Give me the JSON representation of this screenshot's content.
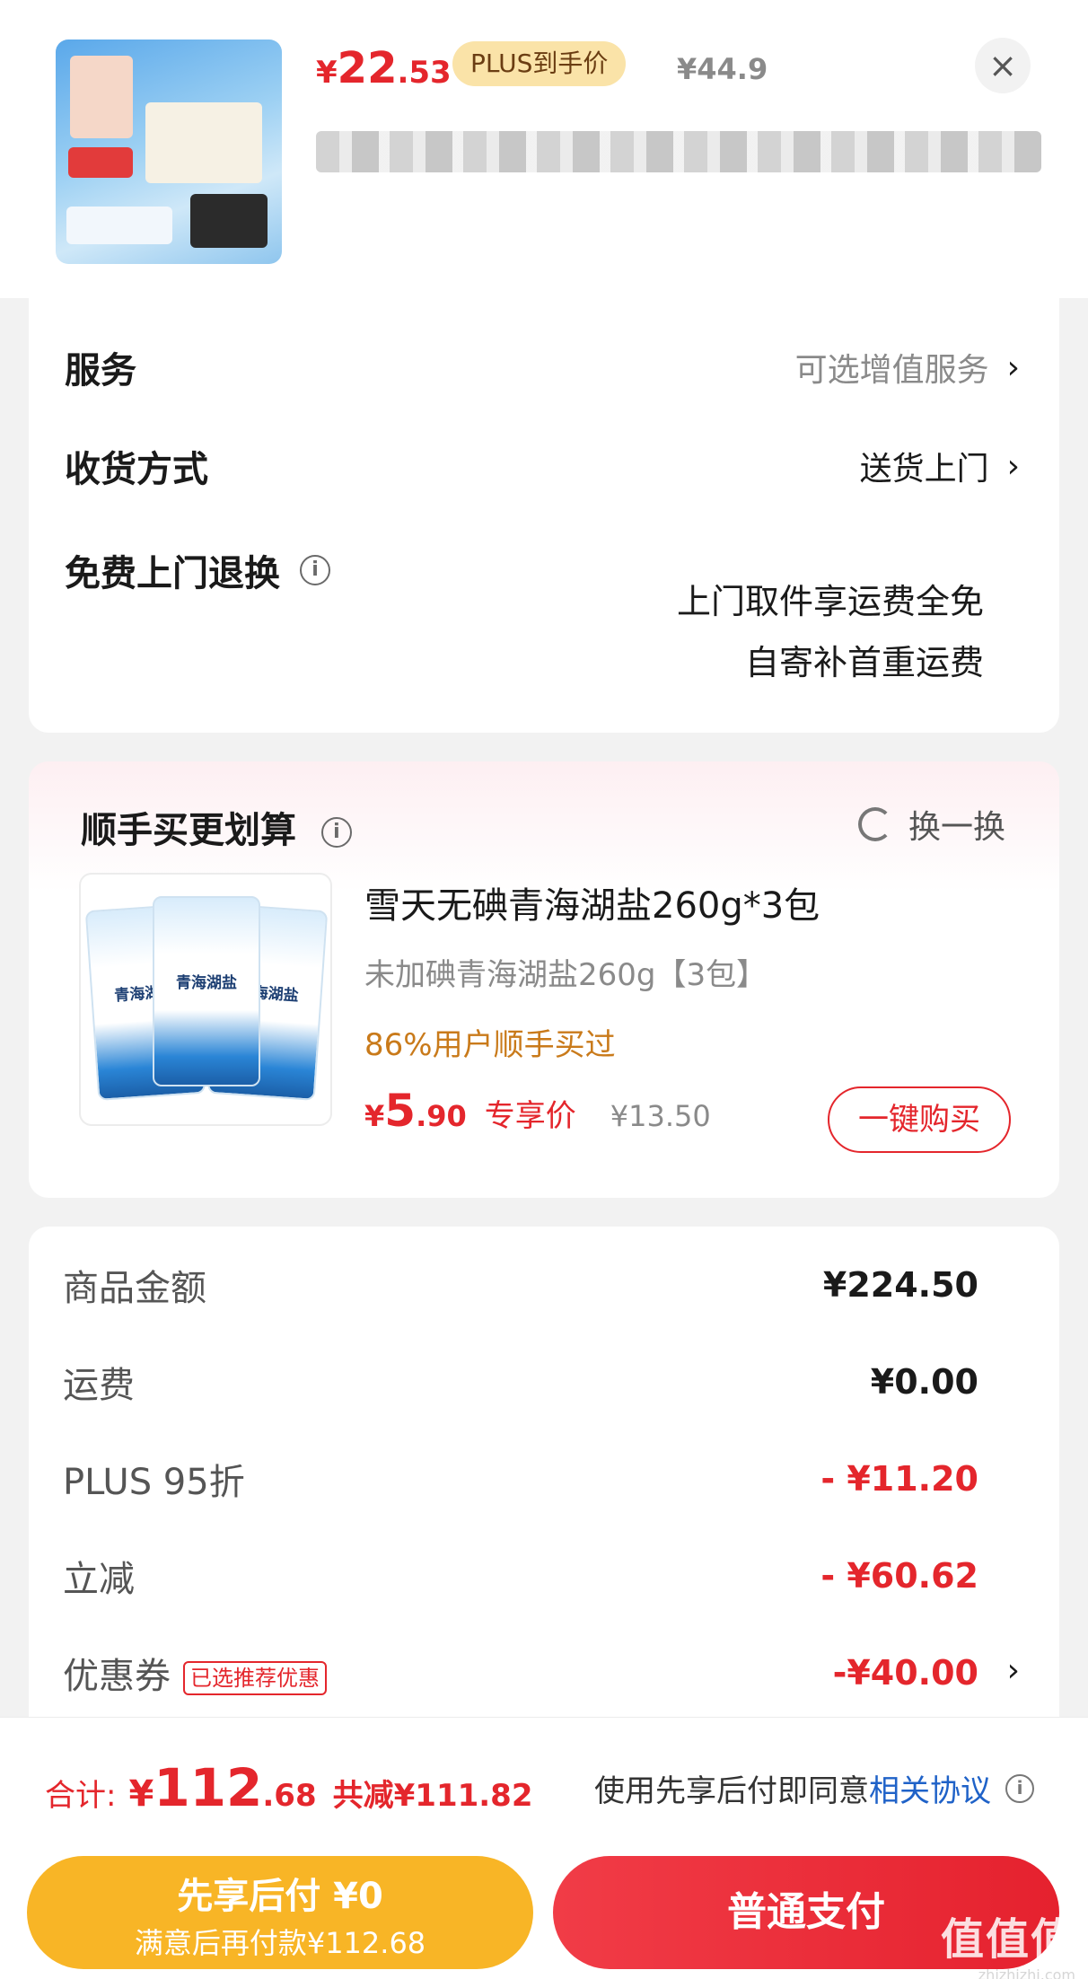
{
  "header": {
    "price_currency": "¥",
    "price_int": "22",
    "price_dec": ".53",
    "plus_tag": "PLUS到手价",
    "original_price": "¥44.9",
    "close_icon": "close-icon"
  },
  "options": {
    "service_label": "服务",
    "service_value": "可选增值服务",
    "delivery_label": "收货方式",
    "delivery_value": "送货上门",
    "return_label": "免费上门退换",
    "return_line1": "上门取件享运费全免",
    "return_line2": "自寄补首重运费",
    "info_glyph": "i",
    "chevron": "›"
  },
  "addon": {
    "title": "顺手买更划算",
    "refresh_label": "换一换",
    "product_name": "雪天无碘青海湖盐260g*3包",
    "product_spec": "未加碘青海湖盐260g【3包】",
    "bag_label": "青海湖盐",
    "note": "86%用户顺手买过",
    "price_currency": "¥",
    "price_int": "5",
    "price_dec": ".90",
    "price_label": "专享价",
    "original_price": "¥13.50",
    "buy_button": "一键购买"
  },
  "summary": {
    "items": [
      {
        "label": "商品金额",
        "value": "¥224.50"
      },
      {
        "label": "运费",
        "value": "¥0.00"
      },
      {
        "label": "PLUS 95折",
        "value": "- ¥11.20"
      },
      {
        "label": "立减",
        "value": "- ¥60.62"
      },
      {
        "label": "优惠券",
        "value": "-¥40.00"
      }
    ],
    "coupon_tag": "已选推荐优惠"
  },
  "footer": {
    "total_label": "合计:",
    "total_currency": "¥",
    "total_int": "112",
    "total_dec": ".68",
    "saved": "共减¥111.82",
    "agree_text": "使用先享后付即同意",
    "agree_link": "相关协议",
    "pay_later_title": "先享后付 ¥0",
    "pay_later_sub": "满意后再付款¥112.68",
    "pay_now": "普通支付"
  },
  "watermark": {
    "text": "值值值",
    "url": "zhizhizhi.com"
  },
  "colors": {
    "accent_red": "#e4262c",
    "pay_later_yellow": "#f8b526",
    "link_blue": "#1f62c8",
    "note_orange": "#c97a1a"
  }
}
